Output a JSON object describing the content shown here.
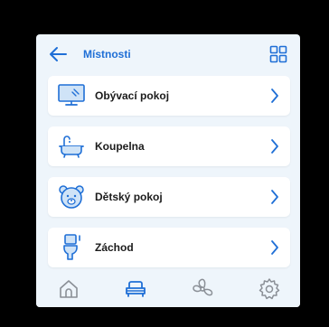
{
  "header": {
    "title": "Místnosti",
    "back_icon": "arrow-left-icon",
    "view_icon": "grid-icon"
  },
  "rooms": [
    {
      "label": "Obývací pokoj",
      "icon": "tv-icon"
    },
    {
      "label": "Koupelna",
      "icon": "bathtub-icon"
    },
    {
      "label": "Dětský pokoj",
      "icon": "teddy-bear-icon"
    },
    {
      "label": "Záchod",
      "icon": "toilet-icon"
    }
  ],
  "nav": {
    "items": [
      {
        "icon": "home-icon",
        "active": false
      },
      {
        "icon": "sofa-icon",
        "active": true
      },
      {
        "icon": "fan-icon",
        "active": false
      },
      {
        "icon": "settings-icon",
        "active": false
      }
    ]
  },
  "colors": {
    "accent": "#1f6fd6",
    "background": "#eef5fb",
    "card": "#ffffff",
    "inactive_icon": "#8a8f96"
  }
}
